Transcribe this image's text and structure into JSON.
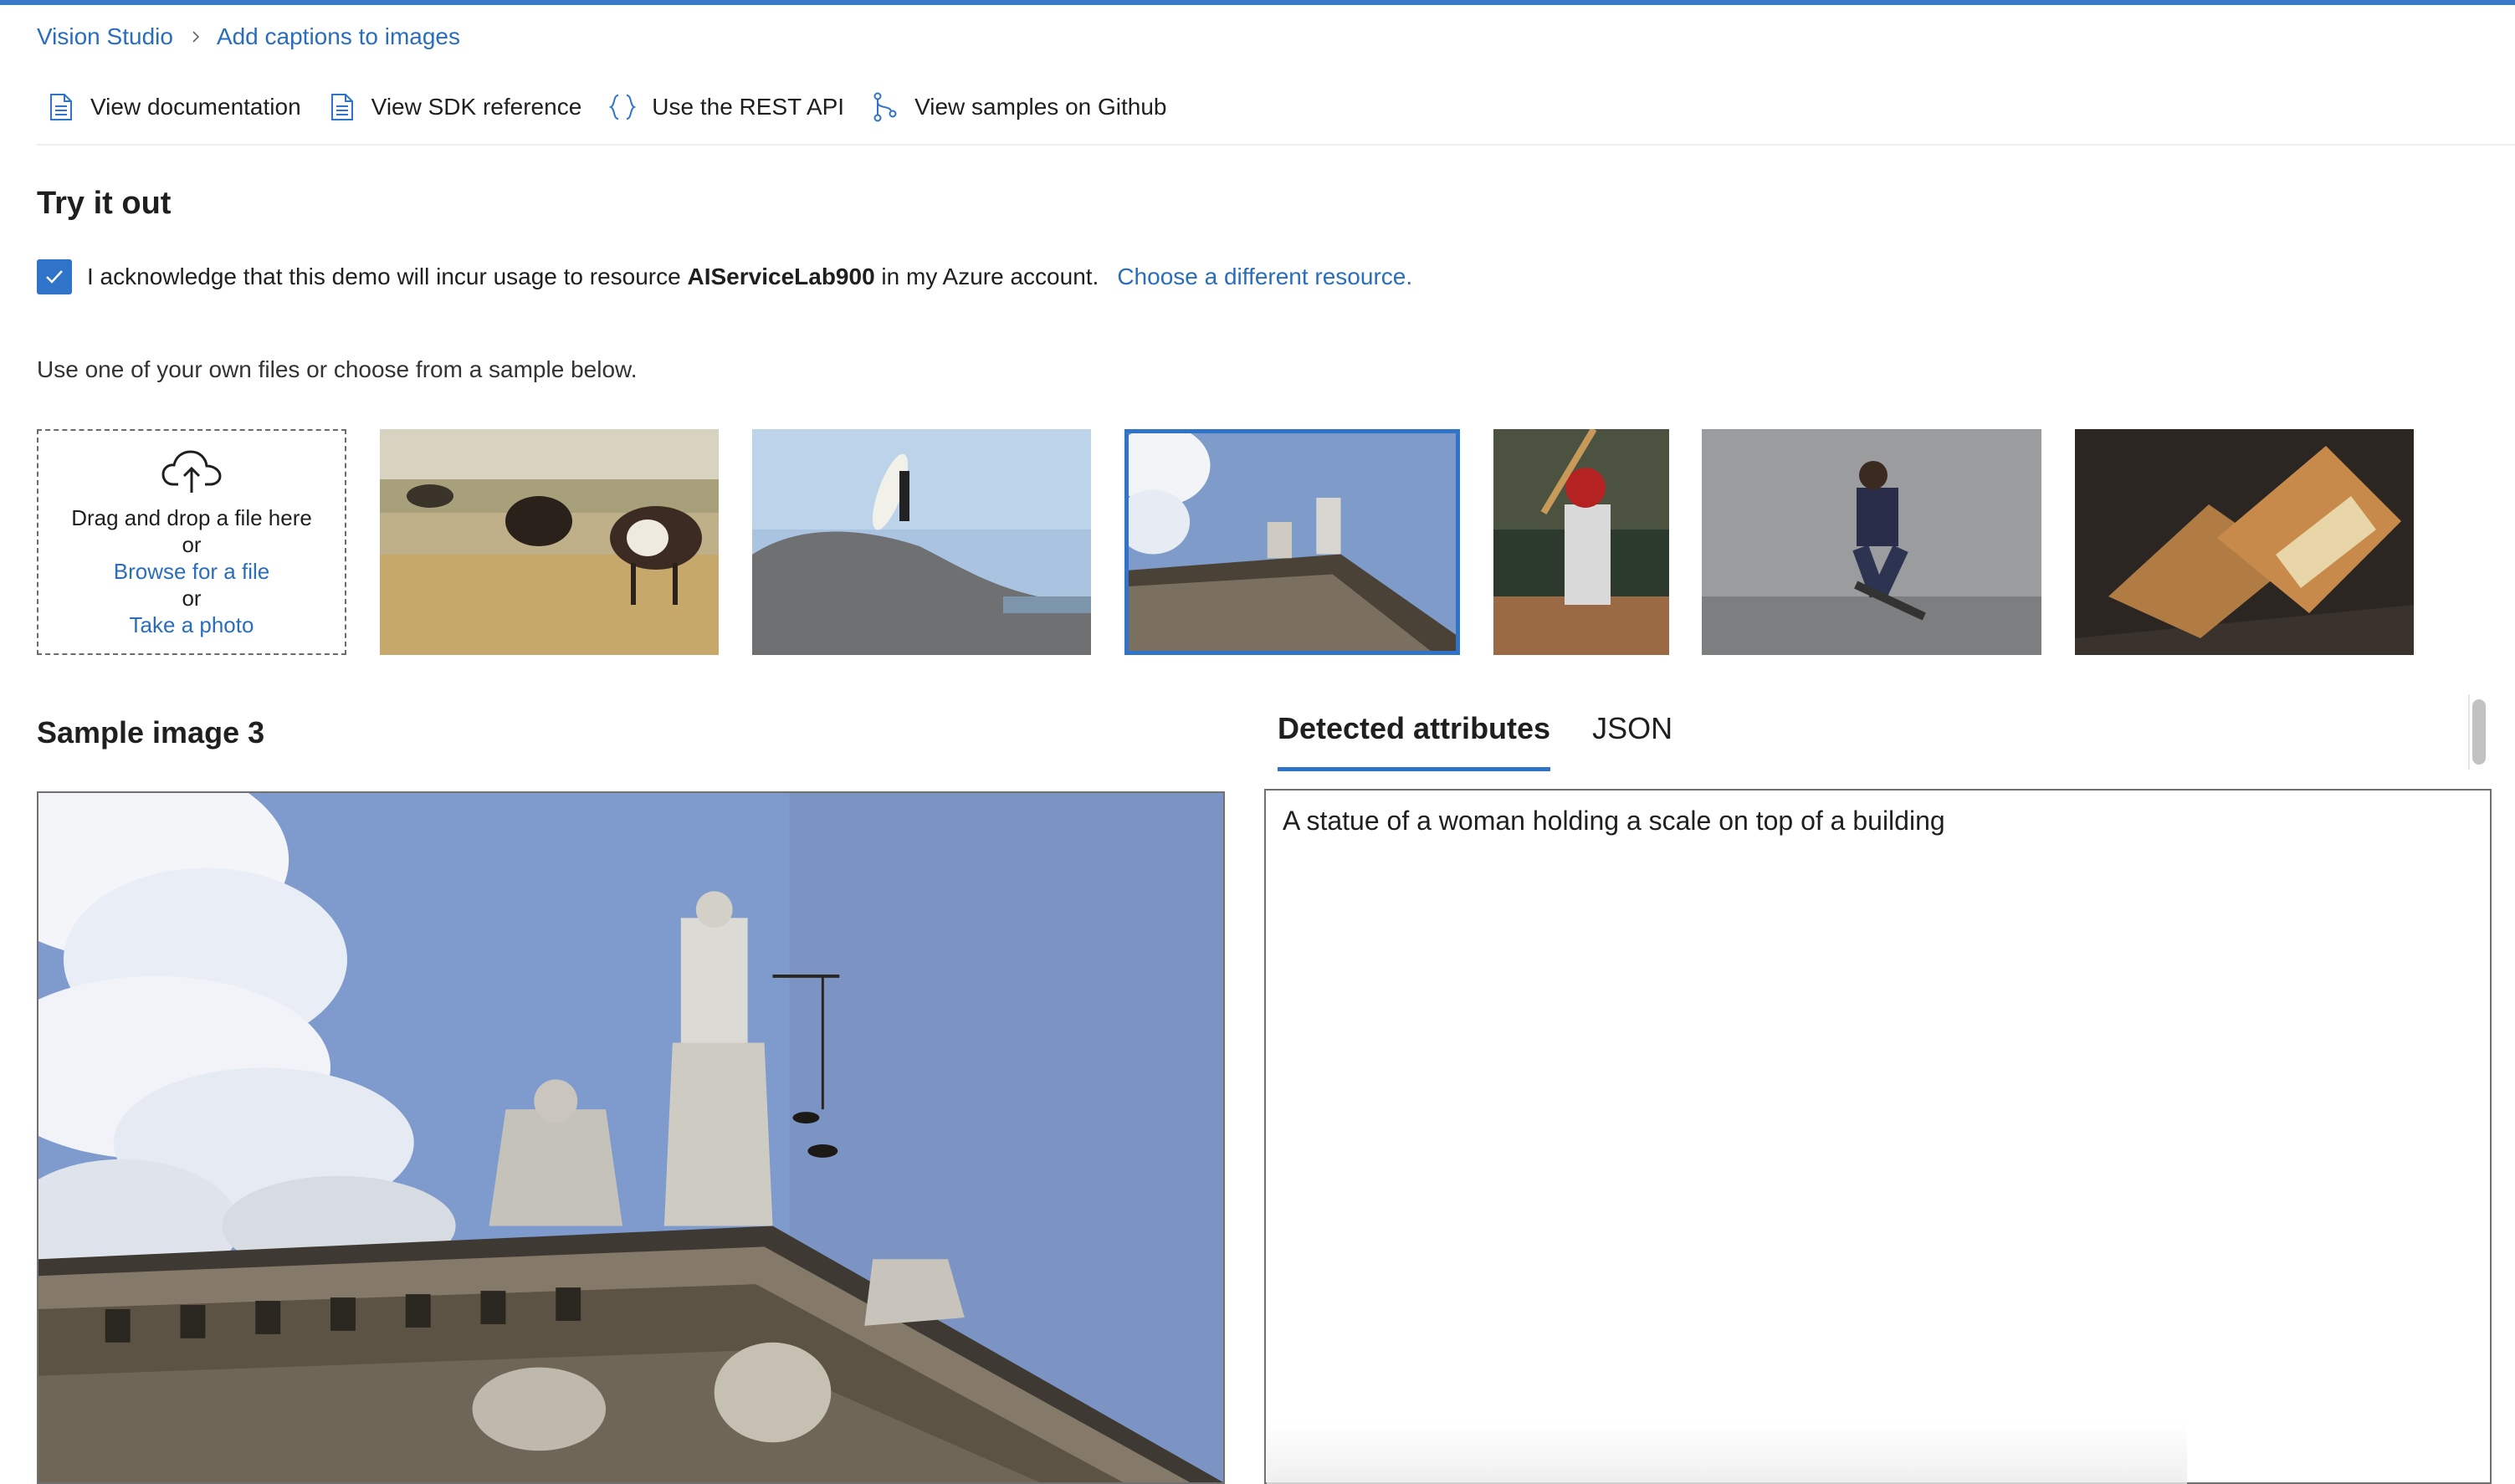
{
  "breadcrumb": {
    "items": [
      "Vision Studio",
      "Add captions to images"
    ]
  },
  "toolbar": {
    "items": [
      {
        "label": "View documentation",
        "icon": "document-icon"
      },
      {
        "label": "View SDK reference",
        "icon": "document-icon"
      },
      {
        "label": "Use the REST API",
        "icon": "braces-icon"
      },
      {
        "label": "View samples on Github",
        "icon": "branch-icon"
      }
    ]
  },
  "try_it_out": {
    "title": "Try it out",
    "ack_checked": true,
    "ack_prefix": "I acknowledge that this demo will incur usage to resource",
    "resource_name": "AIServiceLab900",
    "ack_suffix": "in my Azure account.",
    "change_resource_link": "Choose a different resource.",
    "hint": "Use one of your own files or choose from a sample below."
  },
  "upload": {
    "icon": "cloud-upload-icon",
    "drag_text": "Drag and drop a file here",
    "or_1": "or",
    "browse_link": "Browse for a file",
    "or_2": "or",
    "photo_link": "Take a photo"
  },
  "samples": {
    "selected_index": 3,
    "items": [
      "cows grazing",
      "surfer on rock",
      "statue on building",
      "baseball batter",
      "skateboarder",
      "sandwich"
    ]
  },
  "preview": {
    "title": "Sample image 3"
  },
  "results": {
    "tabs": [
      "Detected attributes",
      "JSON"
    ],
    "active_tab": "Detected attributes",
    "caption": "A statue of a woman holding a scale on top of a building"
  },
  "colors": {
    "accent": "#2f74c9",
    "link": "#2a6ebb"
  }
}
